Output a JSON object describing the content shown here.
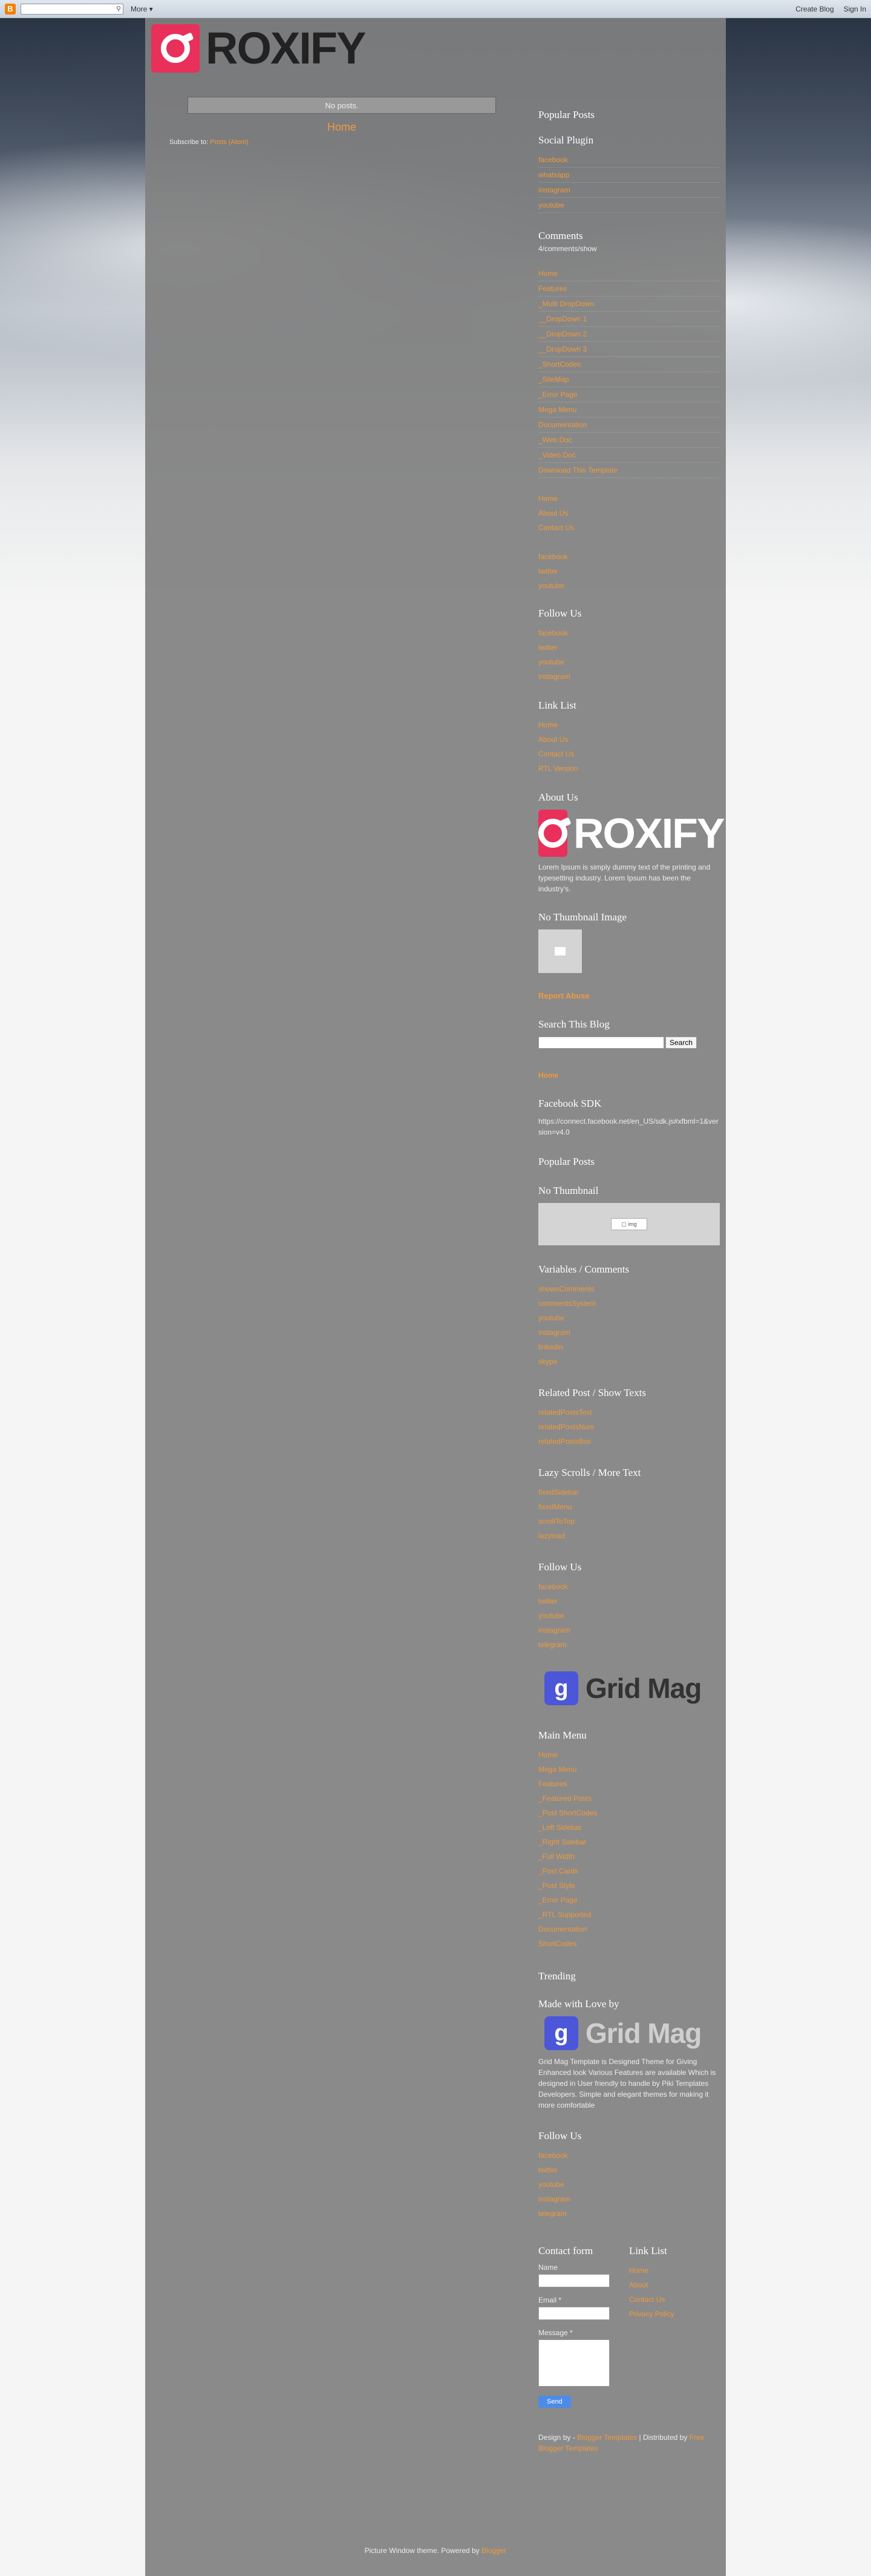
{
  "navbar": {
    "logo": "B",
    "search_placeholder": "",
    "more": "More ▾",
    "create_blog": "Create Blog",
    "sign_in": "Sign In"
  },
  "brand": "ROXIFY",
  "main": {
    "no_posts": "No posts.",
    "home": "Home",
    "subscribe_prefix": "Subscribe to:",
    "subscribe_link": "Posts (Atom)"
  },
  "sidebar": {
    "popular_posts": "Popular Posts",
    "social_plugin": {
      "title": "Social Plugin",
      "items": [
        "facebook",
        "whatsapp",
        "instagram",
        "youtube"
      ]
    },
    "comments": {
      "title": "Comments",
      "text": "4/comments/show"
    },
    "menu_items": [
      "Home",
      "Features",
      "_Multi DropDown",
      "__DropDown 1",
      "__DropDown 2",
      "__DropDown 3",
      "_ShortCodes",
      "_SiteMap",
      "_Error Page",
      "Mega Menu",
      "Documentation",
      "_Web Doc",
      "_Video Doc",
      "Download This Template"
    ],
    "links_a": [
      "Home",
      "About Us",
      "Contact Us"
    ],
    "links_b": [
      "facebook",
      "twitter",
      "youtube"
    ],
    "follow_us_1": {
      "title": "Follow Us",
      "items": [
        "facebook",
        "twitter",
        "youtube",
        "instagram"
      ]
    },
    "link_list_1": {
      "title": "Link List",
      "items": [
        "Home",
        "About Us",
        "Contact Us",
        "RTL Version"
      ]
    },
    "about_us": {
      "title": "About Us",
      "text": "Lorem Ipsum is simply dummy text of the printing and typesetting industry. Lorem Ipsum has been the industry's."
    },
    "no_thumbnail_image": "No Thumbnail Image",
    "report_abuse": "Report Abuse",
    "search_blog": {
      "title": "Search This Blog",
      "button": "Search"
    },
    "home_link": "Home",
    "facebook_sdk": {
      "title": "Facebook SDK",
      "text": "https://connect.facebook.net/en_US/sdk.js#xfbml=1&version=v4.0"
    },
    "popular_posts_2": "Popular Posts",
    "no_thumbnail": "No Thumbnail",
    "variables": {
      "title": "Variables / Comments",
      "items": [
        "shownComments",
        "commentsSystem",
        "youtube",
        "instagram",
        "linkedin",
        "skype"
      ]
    },
    "related": {
      "title": "Related Post / Show Texts",
      "items": [
        "relatedPostsText",
        "relatedPostsNum",
        "relatedPostsBox"
      ]
    },
    "lazy": {
      "title": "Lazy Scrolls / More Text",
      "items": [
        "fixedSidebar",
        "fixedMenu",
        "scrollToTop",
        "lazyload"
      ]
    },
    "follow_us_2": {
      "title": "Follow Us",
      "items": [
        "facebook",
        "twitter",
        "youtube",
        "instagram",
        "telegram"
      ]
    },
    "gridmag": {
      "icon": "g",
      "name": "Grid Mag"
    },
    "main_menu": {
      "title": "Main Menu",
      "items": [
        "Home",
        "Mega Menu",
        "Features",
        "_Featured Posts",
        "_Post ShortCodes",
        "_Left Sidebar",
        "_Right Sidebar",
        "_Full Width",
        "_Post Cards",
        "_Post Style",
        "_Error Page",
        "_RTL Supported",
        "Documentation",
        "ShortCodes"
      ]
    },
    "trending": "Trending",
    "made_with_love": {
      "title": "Made with Love by",
      "text": "Grid Mag Template is Designed Theme for Giving Enhanced look Various Features are available Which is designed in User friendly to handle by Piki Templates Developers. Simple and elegant themes for making it more comfortable"
    },
    "follow_us_3": {
      "title": "Follow Us",
      "items": [
        "facebook",
        "twitter",
        "youtube",
        "instagram",
        "telegram"
      ]
    },
    "contact_form": {
      "title": "Contact form",
      "name": "Name",
      "email": "Email *",
      "message": "Message *",
      "send": "Send"
    },
    "link_list_2": {
      "title": "Link List",
      "items": [
        "Home",
        "About",
        "Contact Us",
        "Privacy Policy"
      ]
    },
    "design_by": {
      "prefix": "Design by - ",
      "link1": "Blogger Templates",
      "mid": " | Distributed by ",
      "link2": "Free Blogger Templates"
    }
  },
  "footer": {
    "text": "Picture Window theme. Powered by ",
    "link": "Blogger"
  }
}
